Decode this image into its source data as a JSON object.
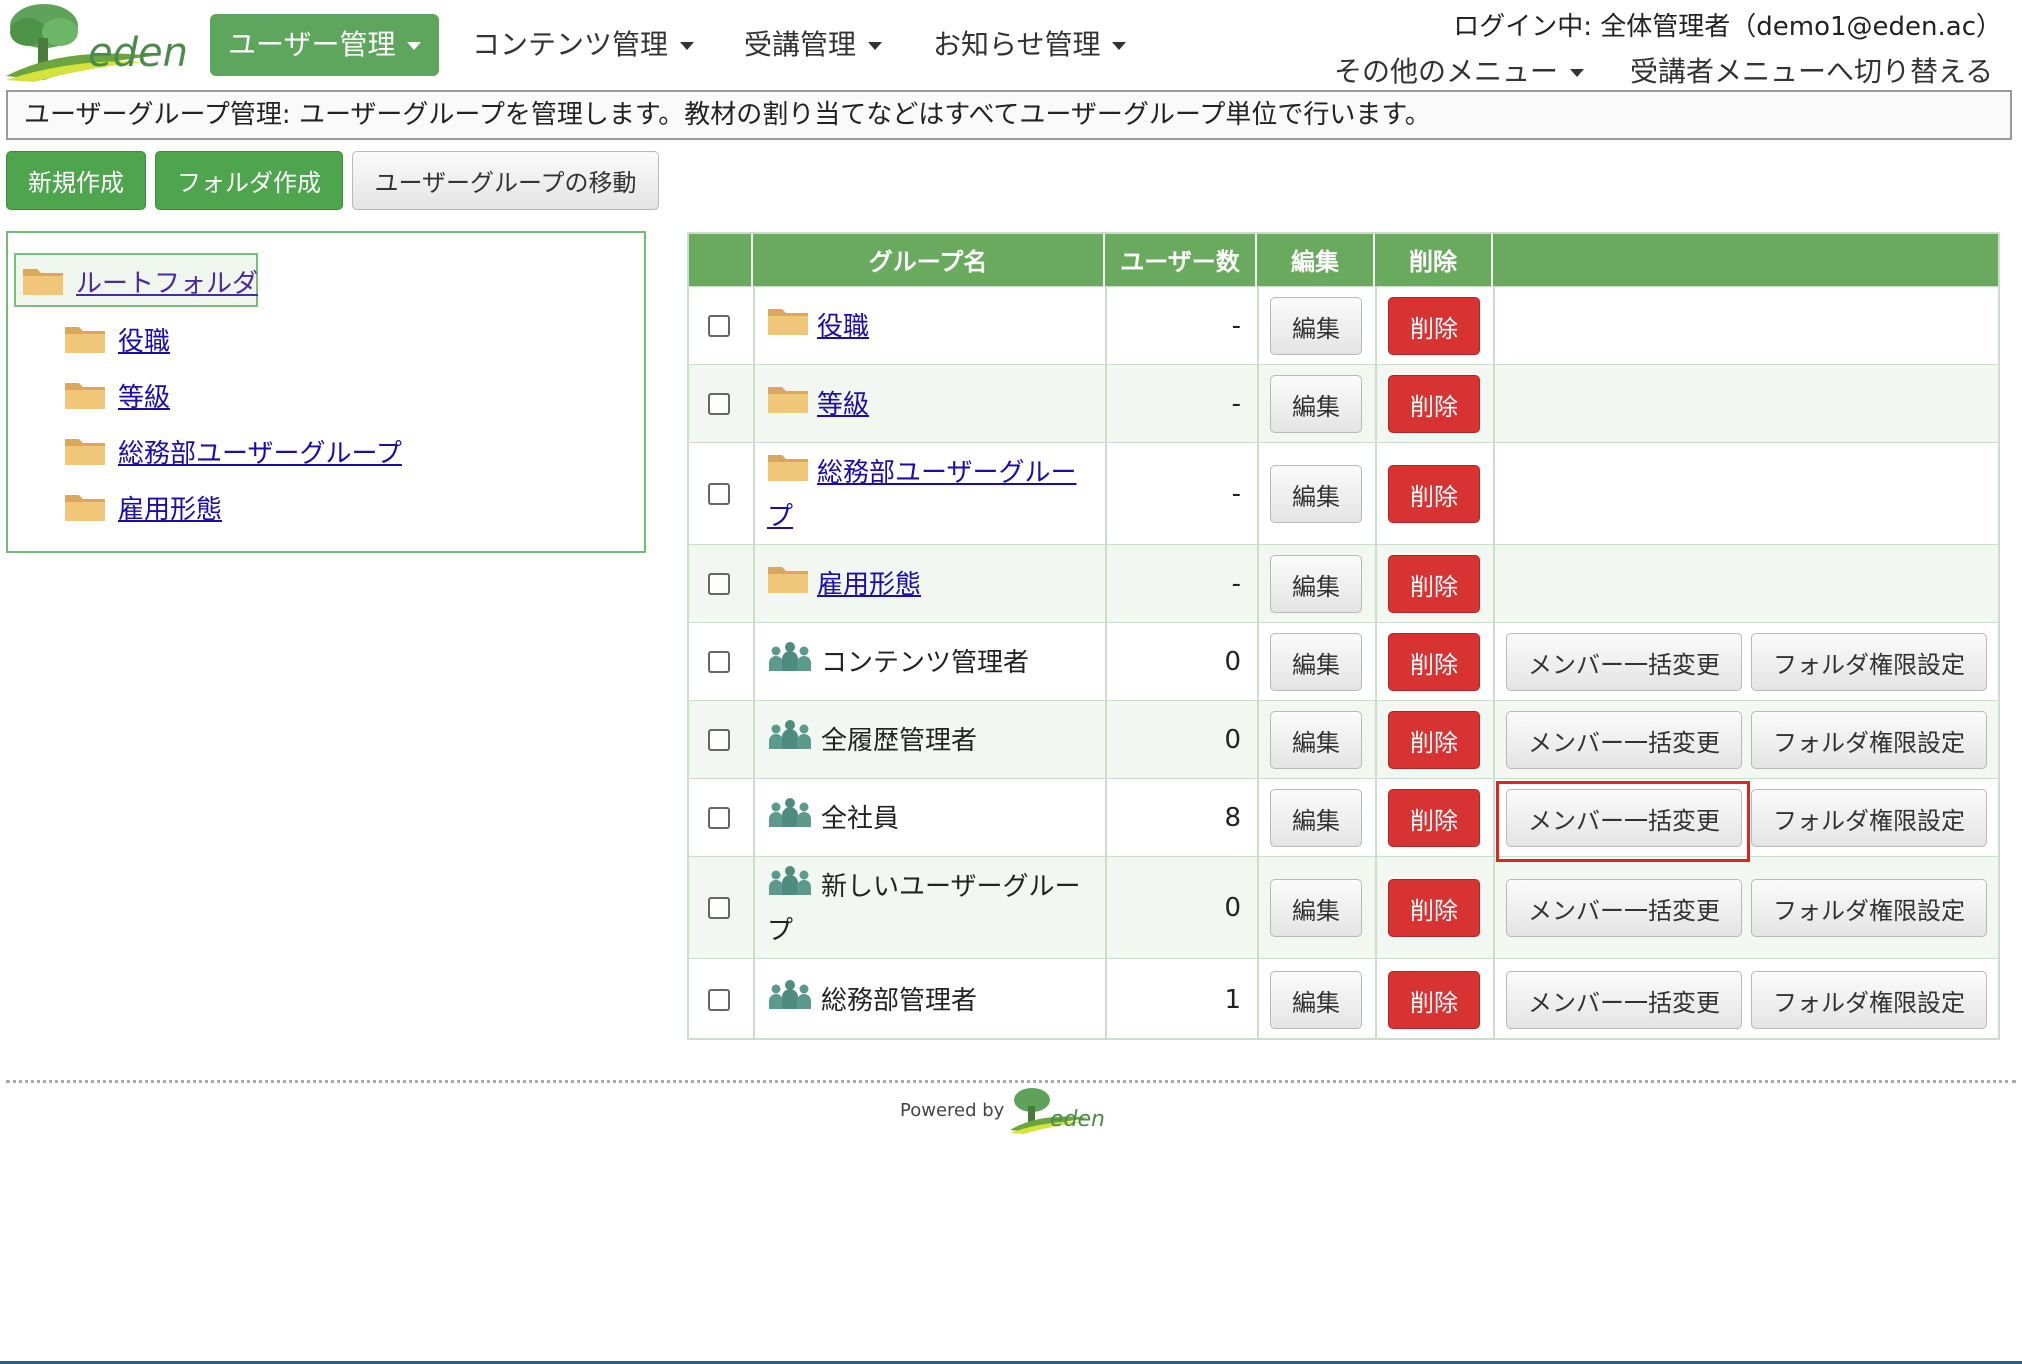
{
  "brand": {
    "logo_text": "eden"
  },
  "nav": [
    {
      "label": "ユーザー管理",
      "active": true
    },
    {
      "label": "コンテンツ管理",
      "active": false
    },
    {
      "label": "受講管理",
      "active": false
    },
    {
      "label": "お知らせ管理",
      "active": false
    }
  ],
  "login_status": "ログイン中: 全体管理者（demo1@eden.ac）",
  "submenus": {
    "other": "その他のメニュー",
    "switch": "受講者メニューへ切り替える"
  },
  "info_text": "ユーザーグループ管理: ユーザーグループを管理します。教材の割り当てなどはすべてユーザーグループ単位で行います。",
  "actions": {
    "new": "新規作成",
    "folder": "フォルダ作成",
    "move": "ユーザーグループの移動"
  },
  "tree": {
    "root": "ルートフォルダ",
    "items": [
      "役職",
      "等級",
      "総務部ユーザーグループ",
      "雇用形態"
    ]
  },
  "table": {
    "headers": {
      "check": "",
      "name": "グループ名",
      "users": "ユーザー数",
      "edit": "編集",
      "delete": "削除",
      "extra": ""
    },
    "edit_label": "編集",
    "delete_label": "削除",
    "member_label": "メンバー一括変更",
    "perm_label": "フォルダ権限設定",
    "rows": [
      {
        "type": "folder",
        "name_line1": "役職",
        "name_line2": "",
        "count": "-"
      },
      {
        "type": "folder",
        "name_line1": "等級",
        "name_line2": "",
        "count": "-"
      },
      {
        "type": "folder",
        "name_line1": "総務部ユーザーグルー",
        "name_line2": "プ",
        "count": "-"
      },
      {
        "type": "folder",
        "name_line1": "雇用形態",
        "name_line2": "",
        "count": "-"
      },
      {
        "type": "group",
        "name_line1": "コンテンツ管理者",
        "name_line2": "",
        "count": "0"
      },
      {
        "type": "group",
        "name_line1": "全履歴管理者",
        "name_line2": "",
        "count": "0"
      },
      {
        "type": "group",
        "name_line1": "全社員",
        "name_line2": "",
        "count": "8"
      },
      {
        "type": "group",
        "name_line1": "新しいユーザーグルー",
        "name_line2": "プ",
        "count": "0"
      },
      {
        "type": "group",
        "name_line1": "総務部管理者",
        "name_line2": "",
        "count": "1"
      }
    ]
  },
  "footer": {
    "powered_by": "Powered by",
    "logo_text": "eden"
  },
  "colors": {
    "accent": "#5ea55e",
    "danger": "#d73333",
    "header_bg": "#6aaa5e",
    "highlight": "#e02424"
  }
}
